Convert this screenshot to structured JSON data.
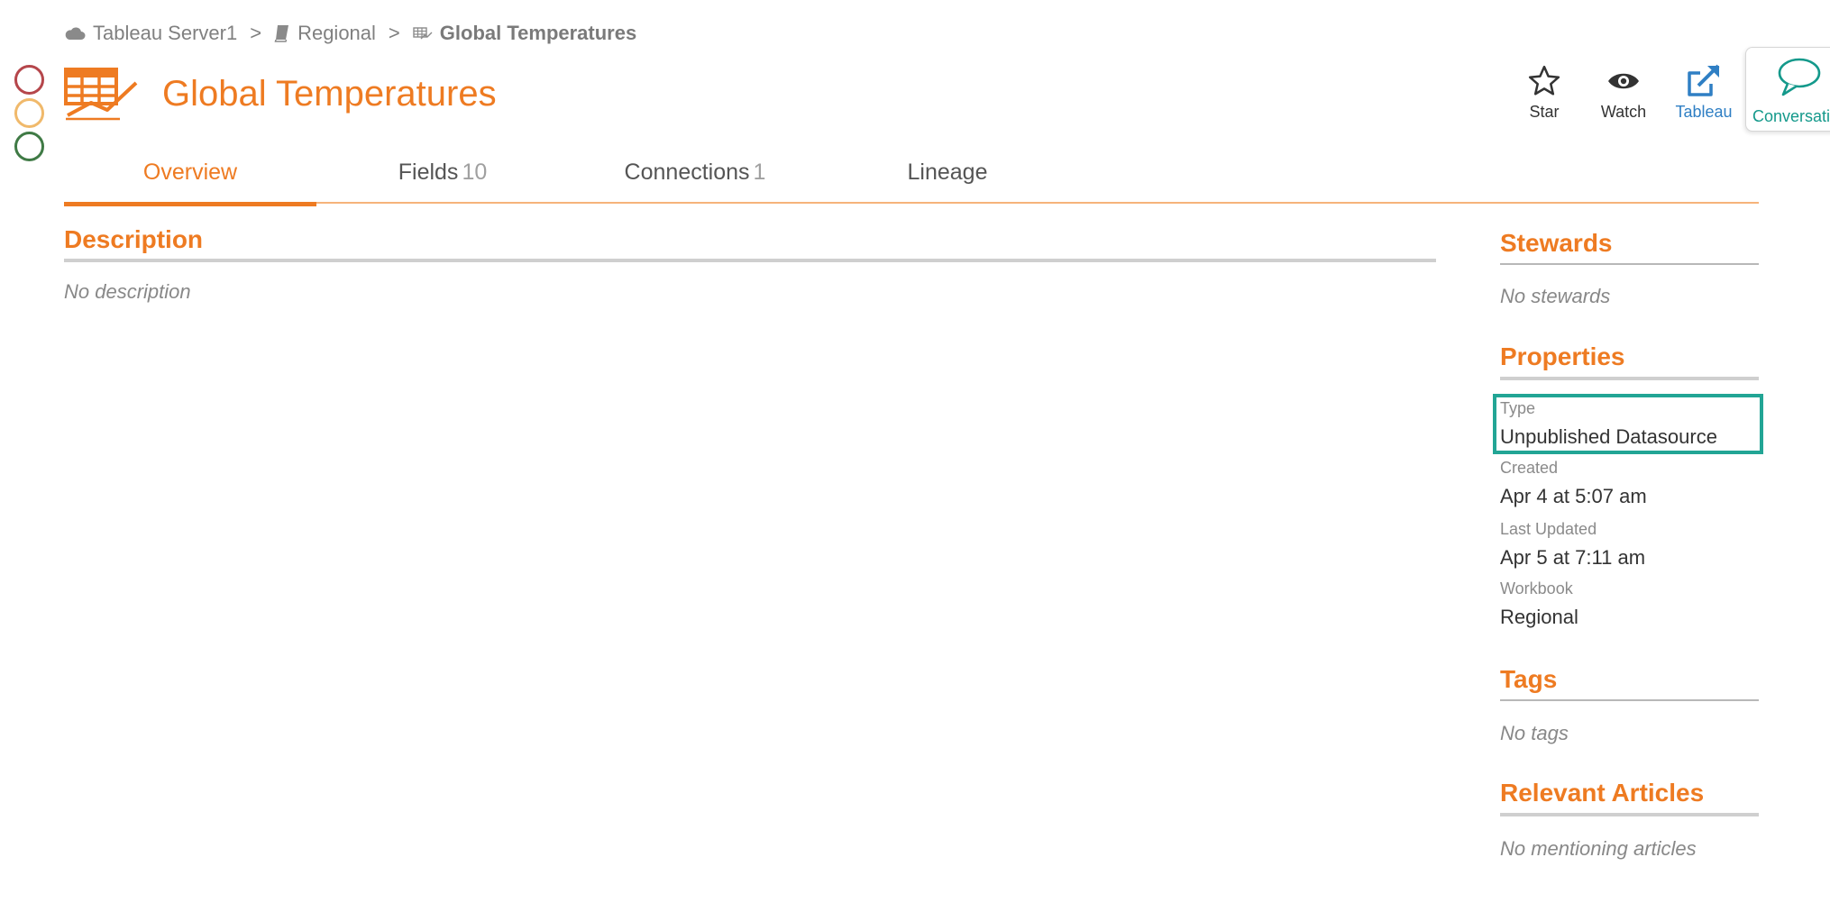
{
  "breadcrumb": {
    "items": [
      {
        "label": "Tableau Server1",
        "icon": "cloud-icon"
      },
      {
        "label": "Regional",
        "icon": "book-icon"
      },
      {
        "label": "Global Temperatures",
        "icon": "datasource-icon"
      }
    ],
    "separator": ">"
  },
  "header": {
    "title": "Global Temperatures",
    "icon": "datasource-icon"
  },
  "actions": {
    "star": "Star",
    "watch": "Watch",
    "tableau": "Tableau",
    "conversation": "Conversations"
  },
  "tabs": [
    {
      "label": "Overview",
      "count": "",
      "active": true
    },
    {
      "label": "Fields",
      "count": "10",
      "active": false
    },
    {
      "label": "Connections",
      "count": "1",
      "active": false
    },
    {
      "label": "Lineage",
      "count": "",
      "active": false
    }
  ],
  "main": {
    "description_title": "Description",
    "description_text": "No description"
  },
  "sidebar": {
    "stewards_title": "Stewards",
    "stewards_text": "No stewards",
    "properties_title": "Properties",
    "properties": {
      "type_label": "Type",
      "type_value": "Unpublished Datasource",
      "created_label": "Created",
      "created_value": "Apr 4 at 5:07 am",
      "updated_label": "Last Updated",
      "updated_value": "Apr 5 at 7:11 am",
      "workbook_label": "Workbook",
      "workbook_value": "Regional"
    },
    "tags_title": "Tags",
    "tags_text": "No tags",
    "articles_title": "Relevant Articles",
    "articles_text": "No mentioning articles"
  },
  "colors": {
    "accent": "#ee7b22",
    "link": "#2f7fc4",
    "teal": "#14998b",
    "highlight": "#22a595"
  }
}
